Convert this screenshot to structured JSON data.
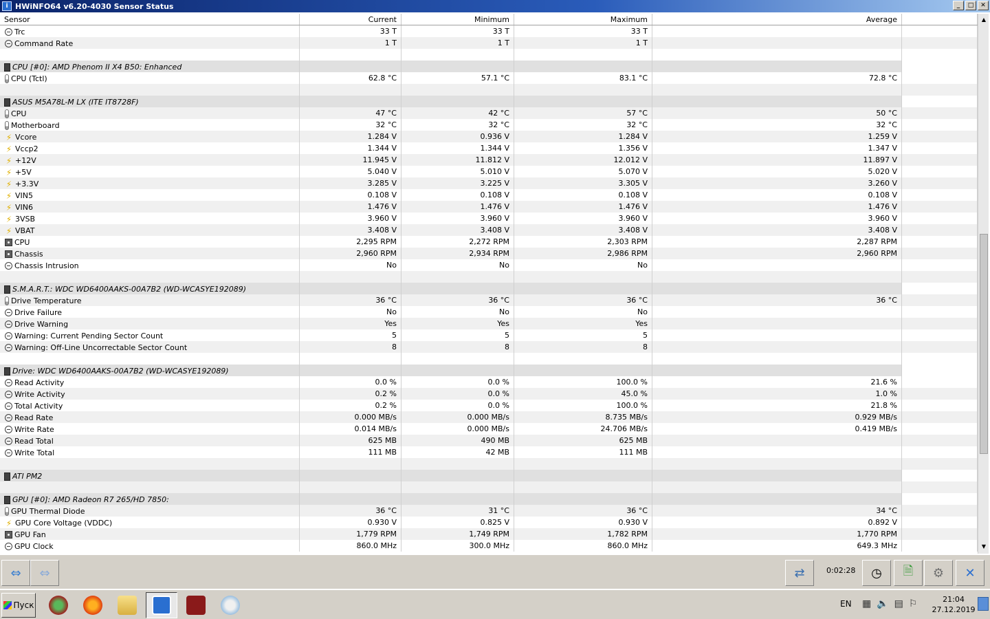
{
  "window": {
    "title": "HWiNFO64 v6.20-4030 Sensor Status",
    "controls": [
      "_",
      "□",
      "✕"
    ]
  },
  "columns": [
    "Sensor",
    "Current",
    "Minimum",
    "Maximum",
    "Average"
  ],
  "rows": [
    {
      "type": "item",
      "icon": "clock",
      "name": "Trc",
      "cur": "33 T",
      "min": "33 T",
      "max": "33 T",
      "avg": ""
    },
    {
      "type": "item",
      "icon": "clock",
      "name": "Command Rate",
      "cur": "1 T",
      "min": "1 T",
      "max": "1 T",
      "avg": ""
    },
    {
      "type": "blank"
    },
    {
      "type": "group",
      "name": "CPU [#0]: AMD Phenom II X4 B50: Enhanced"
    },
    {
      "type": "item",
      "icon": "temp",
      "name": "CPU (Tctl)",
      "cur": "62.8 °C",
      "min": "57.1 °C",
      "max": "83.1 °C",
      "avg": "72.8 °C"
    },
    {
      "type": "blank"
    },
    {
      "type": "group",
      "name": "ASUS M5A78L-M LX (ITE IT8728F)"
    },
    {
      "type": "item",
      "icon": "temp",
      "name": "CPU",
      "cur": "47 °C",
      "min": "42 °C",
      "max": "57 °C",
      "avg": "50 °C"
    },
    {
      "type": "item",
      "icon": "temp",
      "name": "Motherboard",
      "cur": "32 °C",
      "min": "32 °C",
      "max": "32 °C",
      "avg": "32 °C"
    },
    {
      "type": "item",
      "icon": "volt",
      "name": "Vcore",
      "cur": "1.284 V",
      "min": "0.936 V",
      "max": "1.284 V",
      "avg": "1.259 V"
    },
    {
      "type": "item",
      "icon": "volt",
      "name": "Vccp2",
      "cur": "1.344 V",
      "min": "1.344 V",
      "max": "1.356 V",
      "avg": "1.347 V"
    },
    {
      "type": "item",
      "icon": "volt",
      "name": "+12V",
      "cur": "11.945 V",
      "min": "11.812 V",
      "max": "12.012 V",
      "avg": "11.897 V"
    },
    {
      "type": "item",
      "icon": "volt",
      "name": "+5V",
      "cur": "5.040 V",
      "min": "5.010 V",
      "max": "5.070 V",
      "avg": "5.020 V"
    },
    {
      "type": "item",
      "icon": "volt",
      "name": "+3.3V",
      "cur": "3.285 V",
      "min": "3.225 V",
      "max": "3.305 V",
      "avg": "3.260 V"
    },
    {
      "type": "item",
      "icon": "volt",
      "name": "VIN5",
      "cur": "0.108 V",
      "min": "0.108 V",
      "max": "0.108 V",
      "avg": "0.108 V"
    },
    {
      "type": "item",
      "icon": "volt",
      "name": "VIN6",
      "cur": "1.476 V",
      "min": "1.476 V",
      "max": "1.476 V",
      "avg": "1.476 V"
    },
    {
      "type": "item",
      "icon": "volt",
      "name": "3VSB",
      "cur": "3.960 V",
      "min": "3.960 V",
      "max": "3.960 V",
      "avg": "3.960 V"
    },
    {
      "type": "item",
      "icon": "volt",
      "name": "VBAT",
      "cur": "3.408 V",
      "min": "3.408 V",
      "max": "3.408 V",
      "avg": "3.408 V"
    },
    {
      "type": "item",
      "icon": "fan",
      "name": "CPU",
      "cur": "2,295 RPM",
      "min": "2,272 RPM",
      "max": "2,303 RPM",
      "avg": "2,287 RPM"
    },
    {
      "type": "item",
      "icon": "fan",
      "name": "Chassis",
      "cur": "2,960 RPM",
      "min": "2,934 RPM",
      "max": "2,986 RPM",
      "avg": "2,960 RPM"
    },
    {
      "type": "item",
      "icon": "clock",
      "name": "Chassis Intrusion",
      "cur": "No",
      "min": "No",
      "max": "No",
      "avg": ""
    },
    {
      "type": "blank"
    },
    {
      "type": "group",
      "name": "S.M.A.R.T.: WDC WD6400AAKS-00A7B2 (WD-WCASYE192089)"
    },
    {
      "type": "item",
      "icon": "temp",
      "name": "Drive Temperature",
      "cur": "36 °C",
      "min": "36 °C",
      "max": "36 °C",
      "avg": "36 °C"
    },
    {
      "type": "item",
      "icon": "clock",
      "name": "Drive Failure",
      "cur": "No",
      "min": "No",
      "max": "No",
      "avg": ""
    },
    {
      "type": "item",
      "icon": "clock",
      "name": "Drive Warning",
      "cur": "Yes",
      "min": "Yes",
      "max": "Yes",
      "avg": ""
    },
    {
      "type": "item",
      "icon": "clock",
      "name": "Warning: Current Pending Sector Count",
      "cur": "5",
      "min": "5",
      "max": "5",
      "avg": ""
    },
    {
      "type": "item",
      "icon": "clock",
      "name": "Warning: Off-Line Uncorrectable Sector Count",
      "cur": "8",
      "min": "8",
      "max": "8",
      "avg": ""
    },
    {
      "type": "blank"
    },
    {
      "type": "group",
      "name": "Drive: WDC WD6400AAKS-00A7B2 (WD-WCASYE192089)"
    },
    {
      "type": "item",
      "icon": "clock",
      "name": "Read Activity",
      "cur": "0.0 %",
      "min": "0.0 %",
      "max": "100.0 %",
      "avg": "21.6 %"
    },
    {
      "type": "item",
      "icon": "clock",
      "name": "Write Activity",
      "cur": "0.2 %",
      "min": "0.0 %",
      "max": "45.0 %",
      "avg": "1.0 %"
    },
    {
      "type": "item",
      "icon": "clock",
      "name": "Total Activity",
      "cur": "0.2 %",
      "min": "0.0 %",
      "max": "100.0 %",
      "avg": "21.8 %"
    },
    {
      "type": "item",
      "icon": "clock",
      "name": "Read Rate",
      "cur": "0.000 MB/s",
      "min": "0.000 MB/s",
      "max": "8.735 MB/s",
      "avg": "0.929 MB/s"
    },
    {
      "type": "item",
      "icon": "clock",
      "name": "Write Rate",
      "cur": "0.014 MB/s",
      "min": "0.000 MB/s",
      "max": "24.706 MB/s",
      "avg": "0.419 MB/s"
    },
    {
      "type": "item",
      "icon": "clock",
      "name": "Read Total",
      "cur": "625 MB",
      "min": "490 MB",
      "max": "625 MB",
      "avg": ""
    },
    {
      "type": "item",
      "icon": "clock",
      "name": "Write Total",
      "cur": "111 MB",
      "min": "42 MB",
      "max": "111 MB",
      "avg": ""
    },
    {
      "type": "blank"
    },
    {
      "type": "group",
      "name": "ATI PM2"
    },
    {
      "type": "blank"
    },
    {
      "type": "group",
      "name": "GPU [#0]: AMD Radeon R7 265/HD 7850:"
    },
    {
      "type": "item",
      "icon": "temp",
      "name": "GPU Thermal Diode",
      "cur": "36 °C",
      "min": "31 °C",
      "max": "36 °C",
      "avg": "34 °C"
    },
    {
      "type": "item",
      "icon": "volt",
      "name": "GPU Core Voltage (VDDC)",
      "cur": "0.930 V",
      "min": "0.825 V",
      "max": "0.930 V",
      "avg": "0.892 V"
    },
    {
      "type": "item",
      "icon": "fan",
      "name": "GPU Fan",
      "cur": "1,779 RPM",
      "min": "1,749 RPM",
      "max": "1,782 RPM",
      "avg": "1,770 RPM"
    },
    {
      "type": "item",
      "icon": "clock",
      "name": "GPU Clock",
      "cur": "860.0 MHz",
      "min": "300.0 MHz",
      "max": "860.0 MHz",
      "avg": "649.3 MHz"
    }
  ],
  "toolbar": {
    "elapsed": "0:02:28"
  },
  "taskbar": {
    "start_label": "Пуск",
    "lang": "EN",
    "time": "21:04",
    "date": "27.12.2019"
  }
}
